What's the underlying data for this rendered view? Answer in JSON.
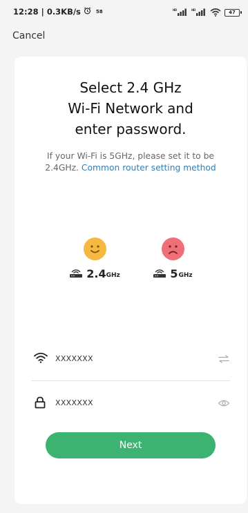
{
  "status_bar": {
    "time_speed": "12:28 | 0.3KB/s",
    "badge": "58",
    "signal_left": "HD",
    "signal_right": "HD",
    "battery": "47"
  },
  "header": {
    "cancel_label": "Cancel"
  },
  "card": {
    "title": "Select 2.4 GHz\nWi-Fi Network and\nenter password.",
    "subtitle_prefix": "If your Wi-Fi is 5GHz, please set it to be 2.4GHz.",
    "subtitle_link": "Common router setting method",
    "bands": [
      {
        "value": "2.4",
        "unit": "GHz",
        "face": "happy",
        "color": "#f5b942"
      },
      {
        "value": "5",
        "unit": "GHz",
        "face": "sad",
        "color": "#ef6f79"
      }
    ],
    "wifi_field": {
      "value": "XXXXXXX",
      "icon": "wifi-icon",
      "trail_icon": "switch-icon"
    },
    "password_field": {
      "value": "XXXXXXX",
      "icon": "lock-icon",
      "trail_icon": "eye-icon"
    },
    "next_label": "Next"
  },
  "colors": {
    "accent": "#3cb371",
    "link": "#2e7fb8",
    "background": "#f4f4f4"
  }
}
